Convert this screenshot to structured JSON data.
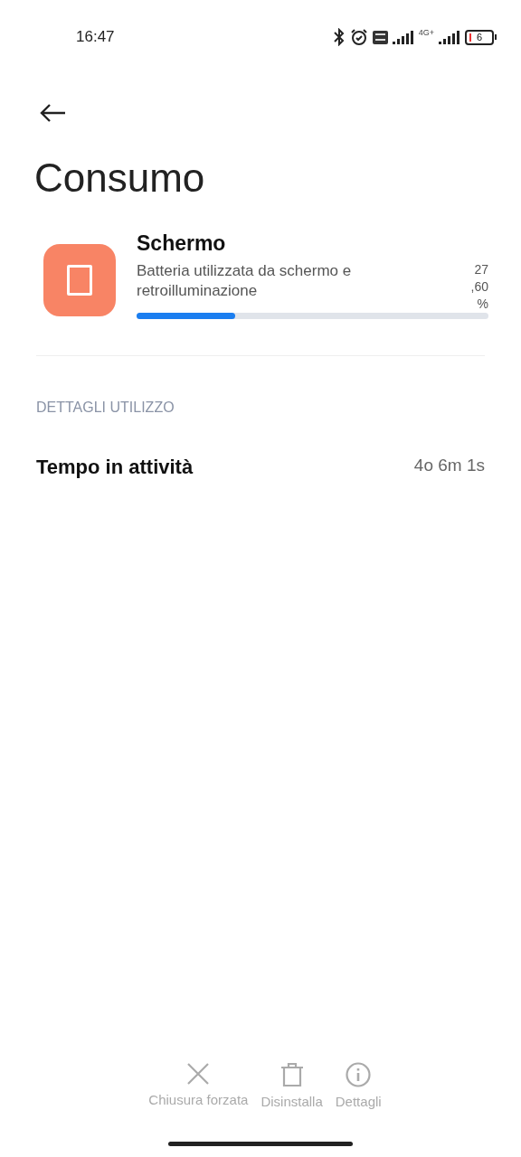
{
  "status_bar": {
    "time": "16:47",
    "network": "4G+",
    "battery": "6"
  },
  "title": "Consumo",
  "item": {
    "name": "Schermo",
    "description": "Batteria utilizzata da schermo e retroilluminazione",
    "percent": [
      "27",
      ",60",
      "%"
    ],
    "level": 0.28
  },
  "section": {
    "heading": "DETTAGLI UTILIZZO",
    "rows": [
      {
        "label": "Tempo in attività",
        "value": "4o 6m 1s"
      }
    ]
  },
  "actions": [
    {
      "kind": "close",
      "label": "Chiusura forzata",
      "disabled": true
    },
    {
      "kind": "delete",
      "label": "Disinstalla",
      "disabled": true
    },
    {
      "kind": "info",
      "label": "Dettagli",
      "disabled": true
    }
  ]
}
